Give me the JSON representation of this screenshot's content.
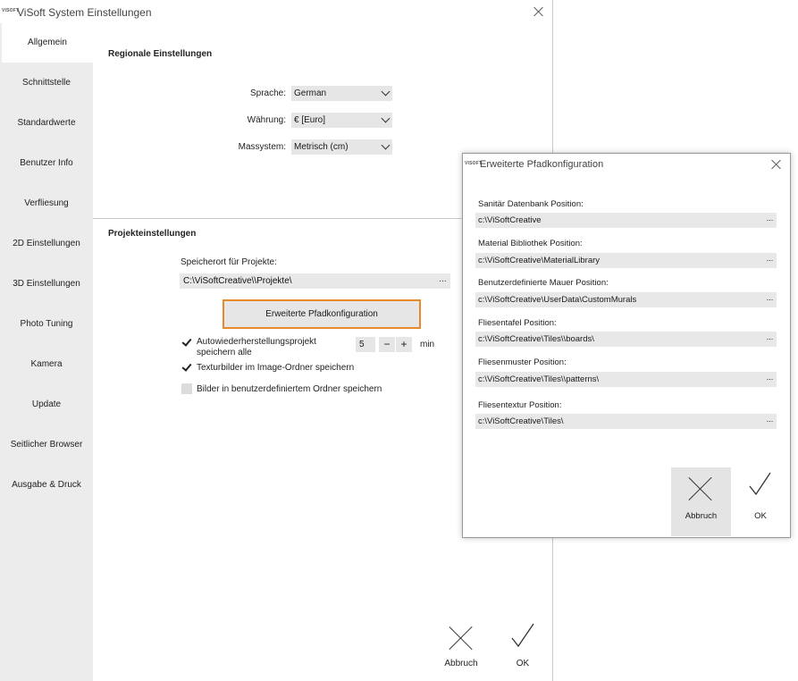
{
  "window": {
    "logo_text": "VISOFT",
    "title": "ViSoft System Einstellungen"
  },
  "sidebar": {
    "items": [
      {
        "label": "Allgemein",
        "active": true
      },
      {
        "label": "Schnittstelle"
      },
      {
        "label": "Standardwerte"
      },
      {
        "label": "Benutzer Info"
      },
      {
        "label": "Verfliesung"
      },
      {
        "label": "2D Einstellungen"
      },
      {
        "label": "3D Einstellungen"
      },
      {
        "label": "Photo Tuning"
      },
      {
        "label": "Kamera"
      },
      {
        "label": "Update"
      },
      {
        "label": "Seitlicher Browser"
      },
      {
        "label": "Ausgabe & Druck"
      }
    ]
  },
  "regional": {
    "title": "Regionale Einstellungen",
    "language_label": "Sprache:",
    "language_value": "German",
    "currency_label": "Währung:",
    "currency_value": "€ [Euro]",
    "unit_label": "Massystem:",
    "unit_value": "Metrisch (cm)"
  },
  "project": {
    "title": "Projekteinstellungen",
    "location_label": "Speicherort für Projekte:",
    "location_value": "C:\\ViSoftCreative\\\\Projekte\\",
    "dots": "...",
    "advanced_button": "Erweiterte Pfadkonfiguration",
    "autosave_label_line1": "Autowiederherstellungsprojekt",
    "autosave_label_line2": "speichern alle",
    "autosave_checked": true,
    "autosave_value": "5",
    "minus": "−",
    "plus": "+",
    "unit_min": "min",
    "texture_label": "Texturbilder im Image-Ordner speichern",
    "texture_checked": true,
    "custom_folder_label": "Bilder in benutzerdefiniertem Ordner speichern",
    "custom_folder_checked": false
  },
  "main_actions": {
    "cancel": "Abbruch",
    "ok": "OK"
  },
  "dialog": {
    "logo_text": "VISOFT",
    "title": "Erweiterte Pfadkonfiguration",
    "fields": [
      {
        "label": "Sanitär Datenbank Position:",
        "value": "c:\\ViSoftCreative"
      },
      {
        "label": "Material Bibliothek Position:",
        "value": "c:\\ViSoftCreative\\MaterialLibrary"
      },
      {
        "label": "Benutzerdefinierte Mauer Position:",
        "value": "c:\\ViSoftCreative\\UserData\\CustomMurals"
      },
      {
        "label": "Fliesentafel Position:",
        "value": "c:\\ViSoftCreative\\Tiles\\\\boards\\"
      },
      {
        "label": "Fliesenmuster Position:",
        "value": "c:\\ViSoftCreative\\Tiles\\\\patterns\\"
      },
      {
        "label": "Fliesentextur Position:",
        "value": "c:\\ViSoftCreative\\Tiles\\"
      }
    ],
    "dots": "...",
    "cancel": "Abbruch",
    "ok": "OK"
  },
  "colors": {
    "highlight_border": "#e8892a",
    "sidebar_bg": "#ececec",
    "field_bg": "#e8e8e8"
  }
}
